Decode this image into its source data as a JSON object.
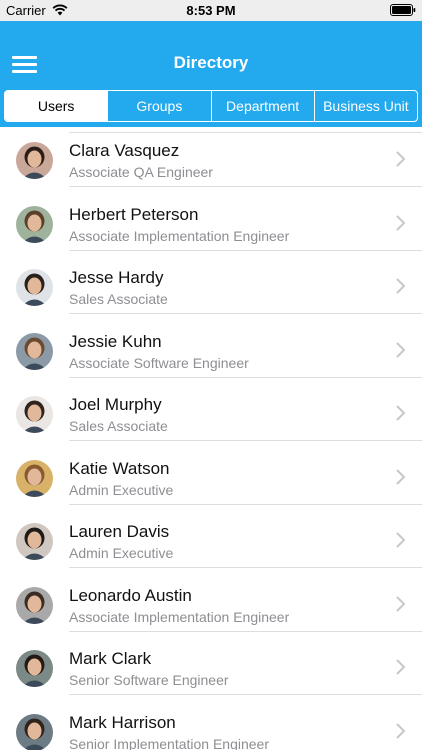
{
  "status_bar": {
    "carrier": "Carrier",
    "time": "8:53 PM"
  },
  "nav": {
    "title": "Directory",
    "menu_icon": "hamburger-menu-icon"
  },
  "tabs": [
    {
      "label": "Users",
      "selected": true
    },
    {
      "label": "Groups",
      "selected": false
    },
    {
      "label": "Department",
      "selected": false
    },
    {
      "label": "Business Unit",
      "selected": false
    }
  ],
  "users": [
    {
      "name": "Clara Vasquez",
      "title": "Associate QA Engineer",
      "avatar_bg": "#c9a89a",
      "avatar_hair": "#2b1d17"
    },
    {
      "name": "Herbert Peterson",
      "title": "Associate Implementation Engineer",
      "avatar_bg": "#9fb29c",
      "avatar_hair": "#5a3f2b"
    },
    {
      "name": "Jesse Hardy",
      "title": "Sales Associate",
      "avatar_bg": "#dfe3e8",
      "avatar_hair": "#2a211c"
    },
    {
      "name": "Jessie Kuhn",
      "title": "Associate Software Engineer",
      "avatar_bg": "#8b9aa6",
      "avatar_hair": "#6b4a32"
    },
    {
      "name": "Joel Murphy",
      "title": "Sales Associate",
      "avatar_bg": "#e9e6e3",
      "avatar_hair": "#2f241d"
    },
    {
      "name": "Katie Watson",
      "title": "Admin Executive",
      "avatar_bg": "#d9b26a",
      "avatar_hair": "#8a5a2e"
    },
    {
      "name": "Lauren Davis",
      "title": "Admin Executive",
      "avatar_bg": "#cfc7c0",
      "avatar_hair": "#1e1a18"
    },
    {
      "name": "Leonardo Austin",
      "title": "Associate Implementation Engineer",
      "avatar_bg": "#a9a9a9",
      "avatar_hair": "#3a2c23"
    },
    {
      "name": "Mark Clark",
      "title": "Senior Software Engineer",
      "avatar_bg": "#7b8a86",
      "avatar_hair": "#231a14"
    },
    {
      "name": "Mark Harrison",
      "title": "Senior Implementation Engineer",
      "avatar_bg": "#6d7b84",
      "avatar_hair": "#2e241c"
    }
  ],
  "colors": {
    "nav_background": "#23a9ee",
    "separator": "#dedede",
    "subtitle": "#8e8e93",
    "chevron": "#c7c7cc"
  }
}
